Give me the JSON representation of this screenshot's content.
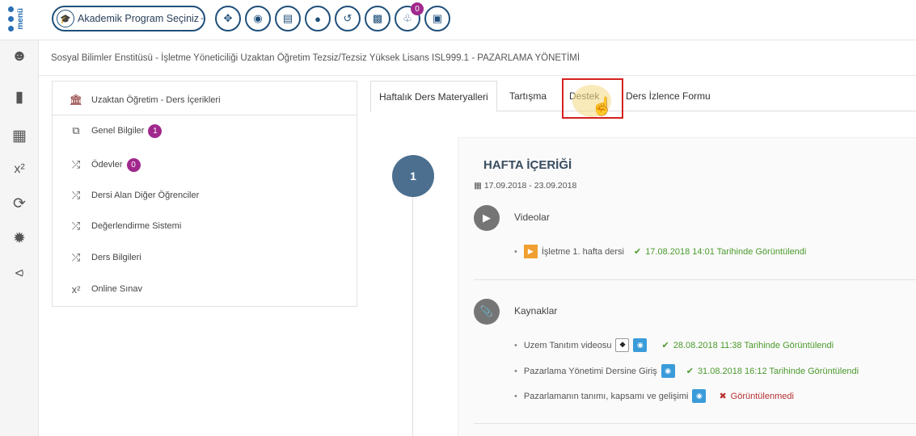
{
  "header": {
    "menu_text": "menü",
    "program_label": "Akademik Program Seçiniz",
    "notification_count": "0",
    "toolbar_icons": [
      "move-icon",
      "eye-icon",
      "card-icon",
      "user-icon",
      "refresh-icon",
      "document-icon",
      "bell-icon",
      "calendar-icon"
    ]
  },
  "sidebar_icons": [
    "user-icon",
    "book-icon",
    "calendar-icon",
    "superscript-icon",
    "refresh-icon",
    "gear-icon",
    "share-icon"
  ],
  "breadcrumb": "Sosyal Bilimler Enstitüsü - İşletme Yöneticiliği Uzaktan Öğretim Tezsiz/Tezsiz Yüksek Lisans ISL999.1 - PAZARLAMA YÖNETİMİ",
  "left_menu": {
    "header": "Uzaktan Öğretim - Ders İçerikleri",
    "items": [
      {
        "label": "Genel Bilgiler",
        "badge": "1"
      },
      {
        "label": "Ödevler",
        "badge": "0"
      },
      {
        "label": "Dersi Alan Diğer Öğrenciler",
        "badge": ""
      },
      {
        "label": "Değerlendirme Sistemi",
        "badge": ""
      },
      {
        "label": "Ders Bilgileri",
        "badge": ""
      },
      {
        "label": "Online Sınav",
        "badge": ""
      }
    ]
  },
  "tabs": [
    "Haftalık Ders Materyalleri",
    "Tartışma",
    "Destek",
    "Ders İzlence Formu"
  ],
  "week": {
    "number": "1",
    "title": "HAFTA İÇERİĞİ",
    "date_range": "17.09.2018 - 23.09.2018",
    "videos": {
      "title": "Videolar",
      "items": [
        {
          "label": "İşletme 1. hafta dersi",
          "status": "17.08.2018 14:01 Tarihinde Görüntülendi"
        }
      ]
    },
    "resources": {
      "title": "Kaynaklar",
      "items": [
        {
          "label": "Uzem Tanıtım videosu",
          "status": "28.08.2018 11:38 Tarihinde Görüntülendi",
          "viewed": true
        },
        {
          "label": "Pazarlama Yönetimi Dersine Giriş",
          "status": "31.08.2018 16:12 Tarihinde Görüntülendi",
          "viewed": true
        },
        {
          "label": "Pazarlamanın tanımı, kapsamı ve gelişimi",
          "status": "Görüntülenmedi",
          "viewed": false
        }
      ]
    }
  }
}
